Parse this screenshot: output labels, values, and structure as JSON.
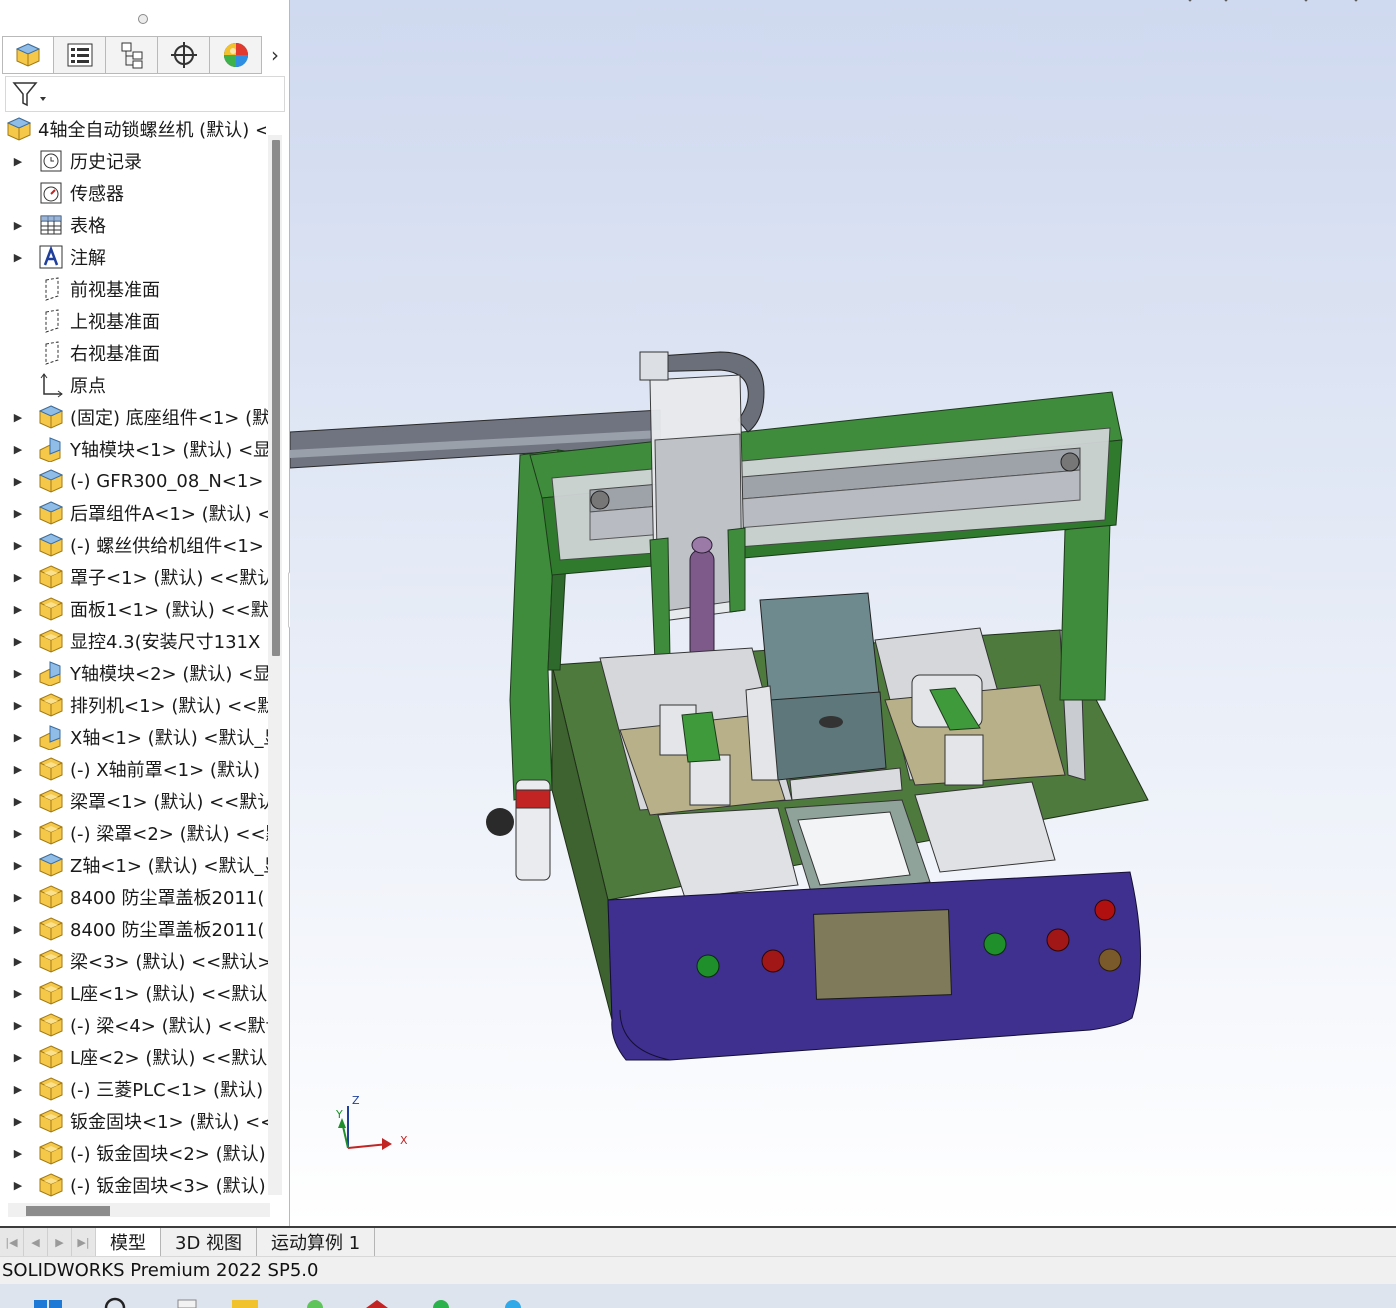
{
  "tree": {
    "root": "4轴全自动锁螺丝机 (默认) <",
    "items": [
      {
        "label": "历史记录",
        "icon": "history-icon",
        "expand": true
      },
      {
        "label": "传感器",
        "icon": "sensor-icon",
        "expand": false
      },
      {
        "label": "表格",
        "icon": "table-icon",
        "expand": true
      },
      {
        "label": "注解",
        "icon": "annotation-icon",
        "expand": true
      },
      {
        "label": "前视基准面",
        "icon": "plane-icon",
        "expand": false
      },
      {
        "label": "上视基准面",
        "icon": "plane-icon",
        "expand": false
      },
      {
        "label": "右视基准面",
        "icon": "plane-icon",
        "expand": false
      },
      {
        "label": "原点",
        "icon": "origin-icon",
        "expand": false
      },
      {
        "label": "(固定) 底座组件<1> (默",
        "icon": "assembly-icon",
        "expand": true
      },
      {
        "label": "Y轴模块<1> (默认) <显",
        "icon": "flex-assembly-icon",
        "expand": true
      },
      {
        "label": "(-) GFR300_08_N<1>",
        "icon": "assembly-icon",
        "expand": true
      },
      {
        "label": "后罩组件A<1> (默认) <",
        "icon": "assembly-icon",
        "expand": true
      },
      {
        "label": "(-) 螺丝供给机组件<1>",
        "icon": "assembly-icon",
        "expand": true
      },
      {
        "label": "罩子<1> (默认) <<默认",
        "icon": "part-icon",
        "expand": true
      },
      {
        "label": "面板1<1> (默认) <<默",
        "icon": "part-icon",
        "expand": true
      },
      {
        "label": "显控4.3(安装尺寸131X",
        "icon": "part-icon",
        "expand": true
      },
      {
        "label": "Y轴模块<2> (默认) <显",
        "icon": "flex-assembly-icon",
        "expand": true
      },
      {
        "label": "排列机<1> (默认) <<默",
        "icon": "part-icon",
        "expand": true
      },
      {
        "label": "X轴<1> (默认) <默认_显",
        "icon": "flex-assembly-icon",
        "expand": true
      },
      {
        "label": "(-) X轴前罩<1> (默认)",
        "icon": "part-icon",
        "expand": true
      },
      {
        "label": "梁罩<1> (默认) <<默认",
        "icon": "part-icon",
        "expand": true
      },
      {
        "label": "(-) 梁罩<2> (默认) <<默",
        "icon": "part-icon",
        "expand": true
      },
      {
        "label": "Z轴<1> (默认) <默认_显",
        "icon": "assembly-icon",
        "expand": true
      },
      {
        "label": "8400 防尘罩盖板2011(",
        "icon": "part-icon",
        "expand": true
      },
      {
        "label": "8400 防尘罩盖板2011(",
        "icon": "part-icon",
        "expand": true
      },
      {
        "label": "梁<3> (默认) <<默认>",
        "icon": "part-icon",
        "expand": true
      },
      {
        "label": "L座<1> (默认) <<默认:",
        "icon": "part-icon",
        "expand": true
      },
      {
        "label": "(-) 梁<4> (默认) <<默认",
        "icon": "part-icon",
        "expand": true
      },
      {
        "label": "L座<2> (默认) <<默认:",
        "icon": "part-icon",
        "expand": true
      },
      {
        "label": "(-) 三菱PLC<1> (默认)",
        "icon": "part-icon",
        "expand": true
      },
      {
        "label": "钣金固块<1> (默认) <<",
        "icon": "part-icon",
        "expand": true
      },
      {
        "label": "(-) 钣金固块<2> (默认)",
        "icon": "part-icon",
        "expand": true
      },
      {
        "label": "(-) 钣金固块<3> (默认)",
        "icon": "part-icon",
        "expand": true
      }
    ]
  },
  "bottom_tabs": [
    "模型",
    "3D 视图",
    "运动算例 1"
  ],
  "status_text": "SOLIDWORKS Premium 2022 SP5.0",
  "triad": {
    "x": "X",
    "y": "Y",
    "z": "Z"
  },
  "colors": {
    "base_green": "#4e7a3d",
    "frame_green": "#3f8c3c",
    "front_panel": "#3f2f8f",
    "viewport_top": "#cfd9ef"
  }
}
